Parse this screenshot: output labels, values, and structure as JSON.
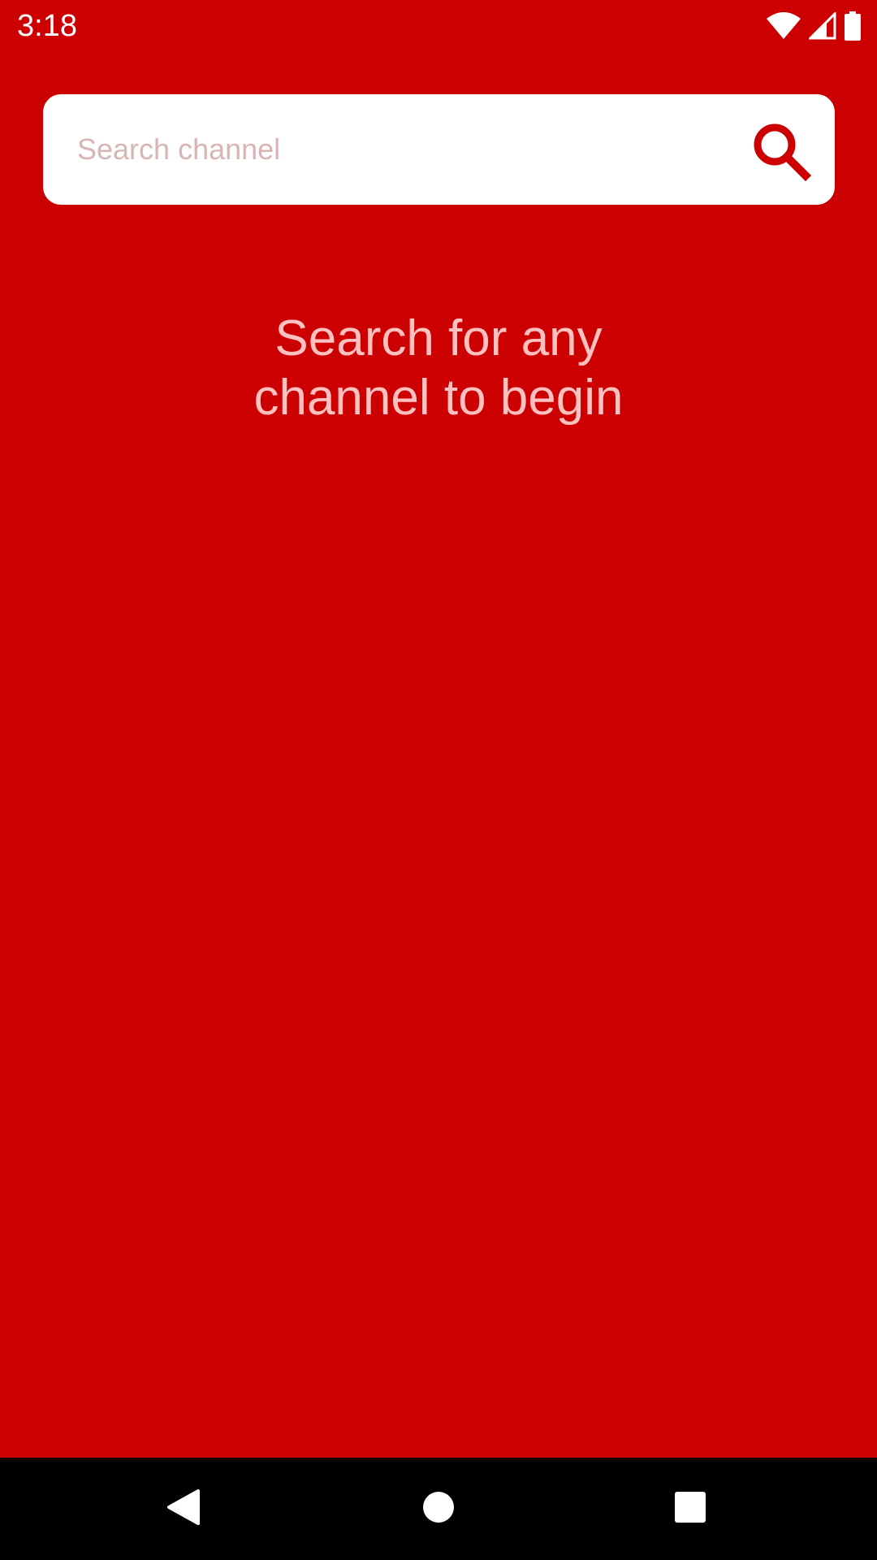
{
  "status_bar": {
    "time": "3:18",
    "icons": [
      "wifi-icon",
      "cellular-signal-icon",
      "battery-icon"
    ]
  },
  "search": {
    "placeholder": "Search channel",
    "value": "",
    "button_icon": "search-icon"
  },
  "empty_state": {
    "line1": "Search for any",
    "line2": "channel to begin"
  },
  "nav_bar": {
    "buttons": [
      "back-icon",
      "home-icon",
      "recents-icon"
    ]
  },
  "colors": {
    "background": "#cc0000",
    "accent": "#cc0000",
    "message_text": "#ffc0c0",
    "placeholder_text": "#d8b5b5",
    "nav_background": "#000000"
  }
}
